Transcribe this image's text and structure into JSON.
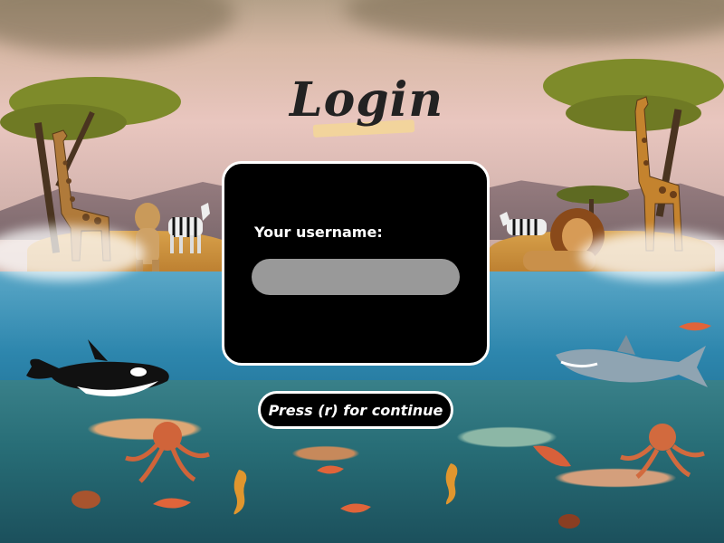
{
  "title": "Login",
  "panel": {
    "username_label": "Your username:",
    "username_value": "",
    "username_placeholder": ""
  },
  "continue_button": {
    "label": "Press (r) for continue"
  },
  "colors": {
    "panel_bg": "#000000",
    "panel_border": "#ffffff",
    "input_bg": "#999999",
    "title_underline": "#f2d49c"
  },
  "background": {
    "animals": [
      "giraffe",
      "lioness",
      "zebra",
      "lion",
      "orca",
      "shark",
      "octopus",
      "seahorse",
      "shrimp"
    ],
    "scenes": [
      "acacia-tree",
      "savanna",
      "ocean",
      "coral-reef"
    ]
  }
}
